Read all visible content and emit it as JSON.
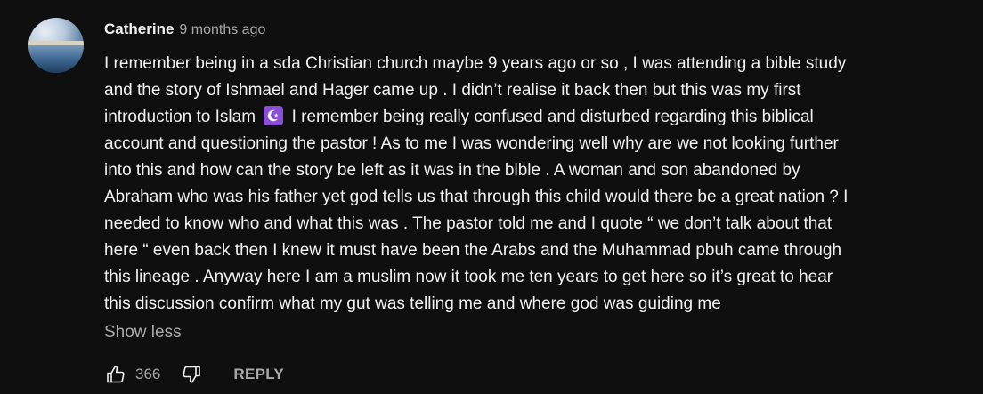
{
  "comment": {
    "author": "Catherine",
    "timestamp": "9 months ago",
    "lines": [
      "I remember being in a sda Christian church maybe 9 years ago or so , I was attending a bible study",
      "and the story of Ishmael and Hager came up . I didn’t realise it back then but this was my first",
      "introduction to Islam",
      "I remember being really confused and disturbed regarding this biblical",
      "account and questioning the pastor ! As to me I was wondering well why are we not looking further",
      "into this and how can the story be left as it was in the bible . A woman and son abandoned by",
      "Abraham who was his father yet god tells us that through this child would there be a great nation ? I",
      "needed to know who and what this was . The pastor told me and I quote “ we don’t talk about that",
      "here “ even back then I knew it must  have been the Arabs and the Muhammad pbuh came through",
      "this lineage . Anyway here I am a muslim now it took me ten years to get here so it’s great to hear",
      "this discussion confirm what my gut was telling me and where god was guiding me"
    ],
    "emoji_icon": "star-and-crescent-icon",
    "show_less_label": "Show less",
    "like_count": "366",
    "reply_label": "REPLY"
  },
  "colors": {
    "background": "#0f0f0f",
    "text_primary": "#f1f1f1",
    "text_secondary": "#aaaaaa",
    "emoji_bg": "#8a4fd6"
  }
}
